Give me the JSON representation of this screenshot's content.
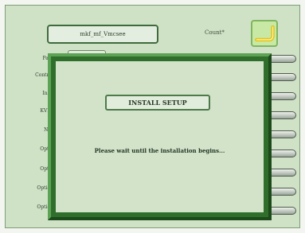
{
  "header": {
    "filename": "mkf_mf_Vmcsee",
    "count_label": "Count*",
    "folder_icon": "folder-icon"
  },
  "menu": {
    "items": [
      {
        "label": "Pass"
      },
      {
        "label": "Control"
      },
      {
        "label": "Instl"
      },
      {
        "label": "KVDr"
      },
      {
        "label": "Nes"
      },
      {
        "label": "Optio"
      },
      {
        "label": "Optio"
      },
      {
        "label": "Option"
      },
      {
        "label": "Option"
      }
    ]
  },
  "dialog": {
    "title": "INSTALL SETUP",
    "message": "Please wait until the installation begins..."
  },
  "colors": {
    "screen_bg": "#cfe2c6",
    "dialog_frame": "#2f6f2b",
    "dialog_bg": "#d2e3ca",
    "folder_button_bg": "#c8e9a6"
  }
}
